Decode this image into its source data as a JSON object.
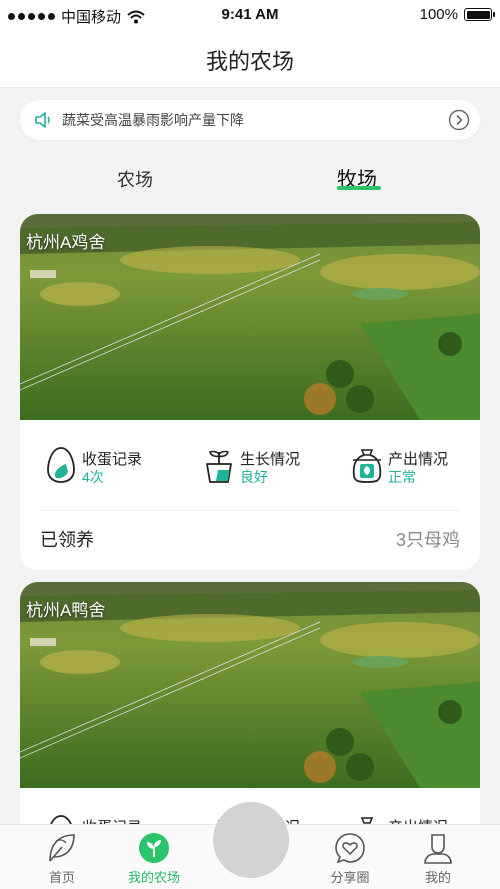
{
  "status_bar": {
    "carrier": "中国移动",
    "time": "9:41 AM",
    "battery": "100%",
    "battery_level": 1.0
  },
  "header": {
    "title": "我的农场"
  },
  "notice": {
    "text": "蔬菜受高温暴雨影响产量下降",
    "icon": "speaker-icon",
    "action_icon": "chevron-right-circle-icon"
  },
  "tabs": [
    {
      "label": "农场",
      "active": false
    },
    {
      "label": "牧场",
      "active": true
    }
  ],
  "accent_color": "#2bc46b",
  "value_color": "#21b39a",
  "cards": [
    {
      "name": "杭州A鸡舍",
      "stats": [
        {
          "label": "收蛋记录",
          "value": "4次",
          "icon": "egg-icon"
        },
        {
          "label": "生长情况",
          "value": "良好",
          "icon": "sprout-pot-icon"
        },
        {
          "label": "产出情况",
          "value": "正常",
          "icon": "harvest-bag-icon"
        }
      ],
      "status_label": "已领养",
      "status_value": "3只母鸡"
    },
    {
      "name": "杭州A鸭舍",
      "stats": [
        {
          "label": "收蛋记录",
          "value": "",
          "icon": "egg-icon"
        },
        {
          "label": "生长情况",
          "value": "",
          "icon": "sprout-pot-icon"
        },
        {
          "label": "产出情况",
          "value": "",
          "icon": "harvest-bag-icon"
        }
      ]
    }
  ],
  "tab_bar": [
    {
      "label": "首页",
      "icon": "leaf-outline-icon",
      "active": false
    },
    {
      "label": "我的农场",
      "icon": "sprout-circle-icon",
      "active": true
    },
    {
      "label": "",
      "icon": "center-action-button",
      "active": false
    },
    {
      "label": "分享圈",
      "icon": "heart-chat-icon",
      "active": false
    },
    {
      "label": "我的",
      "icon": "user-icon",
      "active": false
    }
  ]
}
